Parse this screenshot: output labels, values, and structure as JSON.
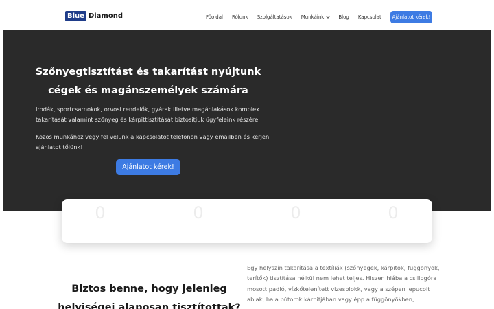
{
  "header": {
    "logo": {
      "box_text": "Blue",
      "text": "Diamond"
    },
    "nav": [
      {
        "label": "Főoldal"
      },
      {
        "label": "Rólunk"
      },
      {
        "label": "Szolgáltatások"
      },
      {
        "label": "Munkáink",
        "has_dropdown": true
      },
      {
        "label": "Blog"
      },
      {
        "label": "Kapcsolat"
      }
    ],
    "cta_label": "Ajánlatot kérek!"
  },
  "hero": {
    "title": "Szőnyegtisztítást és takarítást nyújtunk cégek és magánszemélyek számára",
    "paragraph1": "Irodák, sportcsarnokok, orvosi rendelők, gyárak illetve magánlakások komplex takarítását valamint szőnyeg és kárpittisztítását biztosítjuk ügyfeleink részére.",
    "paragraph2": "Közös munkához vegy fel velünk a kapcsolatot telefonon vagy emailben és kérjen ajánlatot tőlünk!",
    "cta_label": "Ajánlatot kérek!"
  },
  "stats": [
    {
      "value": "0"
    },
    {
      "value": "0"
    },
    {
      "value": "0"
    },
    {
      "value": "0"
    }
  ],
  "section": {
    "title": "Biztos benne, hogy jelenleg helyiségei alaposan tisztítottak?",
    "text": "Egy helyszín takarítása a textíliák (szőnyegek, kárpitok, függönyök, terítők) tisztítása nélkül nem lehet teljes. Hiszen hiába a csillogóra mosott padló, vízkőtelenített vizesblokk, vagy a szépen lepucolt ablak, ha a bútorok kárpitjában vagy épp a függönyökben,"
  },
  "colors": {
    "accent": "#3d7be3",
    "hero_bg": "#2a2a2a",
    "logo_box": "#1f3d8a"
  }
}
